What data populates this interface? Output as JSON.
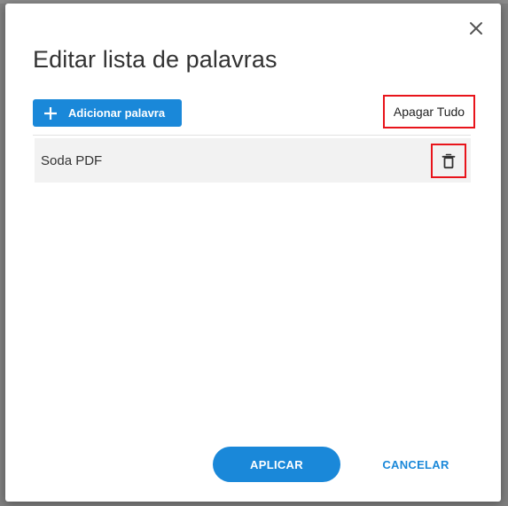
{
  "dialog": {
    "title": "Editar lista de palavras",
    "close_icon": "close-icon"
  },
  "toolbar": {
    "add_label": "Adicionar palavra",
    "add_icon": "plus-icon",
    "clear_all_label": "Apagar Tudo"
  },
  "words": [
    {
      "text": "Soda PDF",
      "delete_icon": "trash-icon"
    }
  ],
  "footer": {
    "apply_label": "APLICAR",
    "cancel_label": "CANCELAR"
  },
  "colors": {
    "accent": "#1a88d9",
    "highlight_border": "#e8141b",
    "item_background": "#f2f2f2"
  }
}
